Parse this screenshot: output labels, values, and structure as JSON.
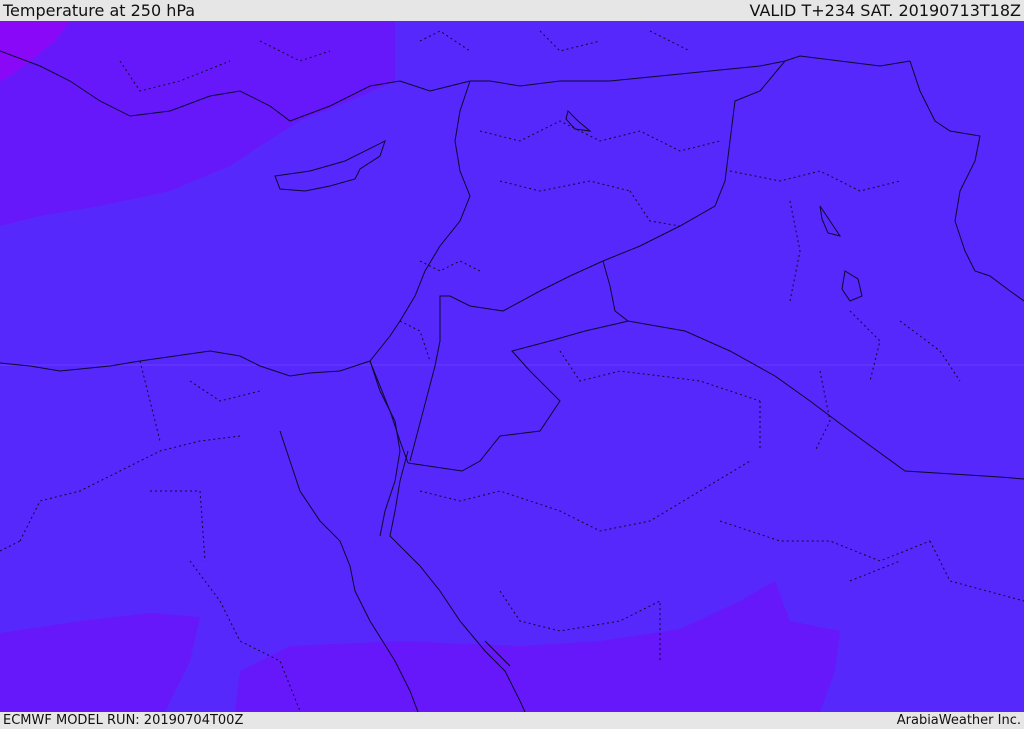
{
  "header": {
    "title": "Temperature at 250 hPa",
    "valid": "VALID T+234 SAT. 20190713T18Z"
  },
  "footer": {
    "model_run": "ECMWF MODEL RUN: 20190704T00Z",
    "credit": "ArabiaWeather Inc."
  },
  "colors": {
    "base": "#5728fb",
    "warm_band": "#6718fb",
    "warmest": "#8a08f8",
    "border": "#0d0830",
    "chrome": "#e6e6e6"
  }
}
